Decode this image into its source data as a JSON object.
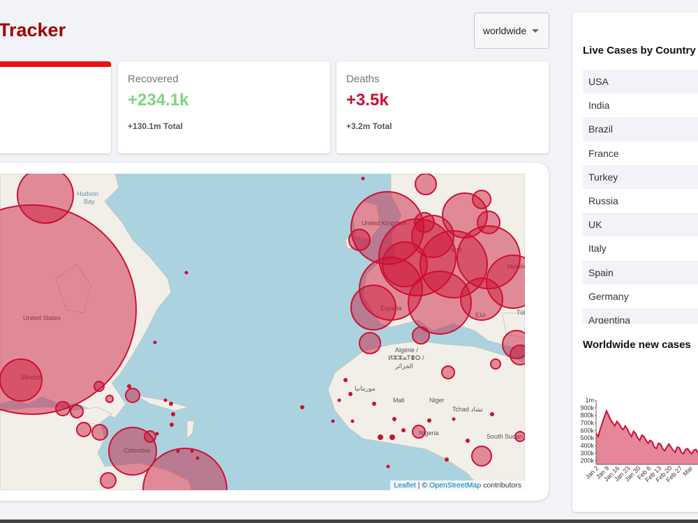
{
  "app": {
    "title": "Tracker"
  },
  "region_select": {
    "value": "worldwide"
  },
  "stats": {
    "recovered": {
      "label": "Recovered",
      "value": "+234.1k",
      "total": "+130.1m Total"
    },
    "deaths": {
      "label": "Deaths",
      "value": "+3.5k",
      "total": "+3.2m Total"
    }
  },
  "map": {
    "labels": {
      "hudson": "Hudson",
      "bay": "Bay",
      "us": "United States",
      "mexico": "México",
      "colombia": "Colombia",
      "uk": "United Kingdom",
      "ukraine": "Україна",
      "turkey": "Türkiye",
      "espana": "España",
      "algeria1": "Algérie /",
      "algeria2": "ⵍⵣⵣⴰⵢⴻⵔ /",
      "algeria3": "الجزائر",
      "mauritania": "موريتانيا",
      "mali": "Mali",
      "niger": "Niger",
      "tchad": "Tchad تشاد",
      "nigeria": "Nigeria",
      "south_sudan": "South Sudan",
      "and_fragment": "and",
      "ella_fragment": "Ελλ"
    },
    "attribution": {
      "leaflet": "Leaflet",
      "sep": " | © ",
      "osm": "OpenStreetMap",
      "contrib": " contributors"
    }
  },
  "sidebar": {
    "live_title": "Live Cases by Country",
    "countries": [
      "USA",
      "India",
      "Brazil",
      "France",
      "Turkey",
      "Russia",
      "UK",
      "Italy",
      "Spain",
      "Germany",
      "Argentina"
    ],
    "graph_title": "Worldwide new cases"
  },
  "chart_data": {
    "type": "area",
    "title": "Worldwide new cases",
    "color": "#cc1034",
    "fill": "rgba(204,16,52,0.5)",
    "y_ticks": [
      "1m",
      "900k",
      "800k",
      "700k",
      "600k",
      "500k",
      "400k",
      "300k",
      "200k"
    ],
    "ylim": [
      150000,
      1000000
    ],
    "x_ticks": [
      "Jan 2",
      "Jan 9",
      "Jan 16",
      "Jan 23",
      "Jan 30",
      "Feb 6",
      "Feb 13",
      "Feb 20",
      "Feb 27",
      "Mar"
    ],
    "values": [
      560000,
      520000,
      620000,
      700000,
      780000,
      860000,
      800000,
      740000,
      700000,
      660000,
      720000,
      690000,
      640000,
      610000,
      660000,
      620000,
      560000,
      520000,
      590000,
      560000,
      500000,
      470000,
      540000,
      520000,
      470000,
      430000,
      470000,
      450000,
      380000,
      360000,
      430000,
      420000,
      360000,
      330000,
      380000,
      420000,
      380000,
      340000,
      310000,
      380000,
      370000,
      310000,
      290000,
      350000,
      360000,
      320000,
      290000,
      340000,
      350000,
      300000
    ]
  }
}
